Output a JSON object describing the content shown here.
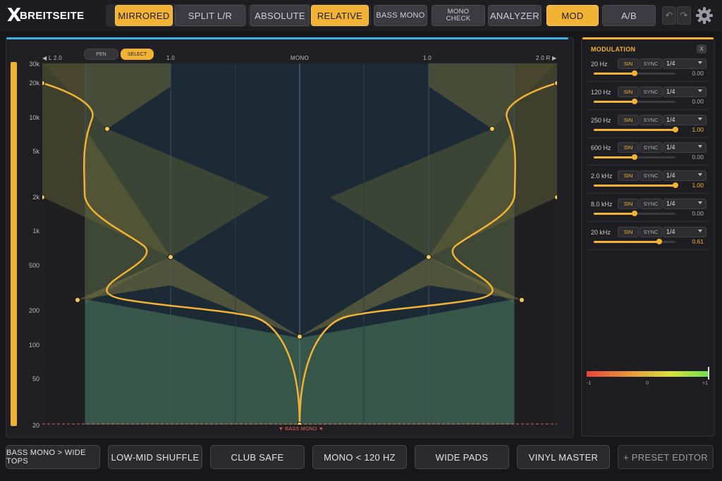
{
  "app": {
    "logo_mark": "X",
    "logo_text": "BREITSEITE"
  },
  "toolbar": {
    "mode": [
      "MIRRORED",
      "SPLIT L/R"
    ],
    "scale": [
      "ABSOLUTE",
      "RELATIVE"
    ],
    "bass_mono": "BASS MONO",
    "mono_check": "MONO CHECK",
    "analyzer": "ANALYZER",
    "mod": "MOD",
    "ab": "A/B",
    "undo_icon": "undo-icon",
    "redo_icon": "redo-icon",
    "settings_icon": "gear-icon",
    "active": [
      "MIRRORED",
      "RELATIVE",
      "MOD"
    ]
  },
  "editor": {
    "tools": [
      "PEN",
      "SELECT"
    ],
    "active_tool": "SELECT",
    "x_labels": {
      "left": "L 2.0",
      "left_mid": "1.0",
      "center": "MONO",
      "right_mid": "1.0",
      "right": "2.0 R"
    },
    "y_labels": [
      "30k",
      "20k",
      "10k",
      "5k",
      "2k",
      "1k",
      "500",
      "200",
      "100",
      "50",
      "20"
    ],
    "bass_mono_label": "BASS MONO",
    "colors": {
      "accent": "#f2b233",
      "plot_bg": "#1b2a35",
      "bass_mono_line": "#e2624f"
    }
  },
  "chart_data": {
    "type": "scatter",
    "title": "",
    "xlabel": "",
    "ylabel": "",
    "y_scale": "log",
    "ylim": [
      20,
      30000
    ],
    "xlim": [
      -2.0,
      2.0
    ],
    "series": [
      {
        "x": [
          -2.0,
          -1.6,
          -1.0,
          -1.7,
          0.0,
          0.0,
          1.0,
          1.7,
          1.6,
          2.0
        ],
        "y": [
          20000,
          8000,
          600,
          250,
          120,
          20,
          600,
          250,
          8000,
          20000
        ]
      },
      {
        "x": [
          -2.0,
          2.0
        ],
        "y": [
          2000,
          2000
        ]
      }
    ]
  },
  "modulation": {
    "title": "MODULATION",
    "close": "X",
    "sin": "SIN",
    "sync": "SYNC",
    "bands": [
      {
        "freq": "20 Hz",
        "rate": "1/4",
        "value": "0.00",
        "amount": 0.5
      },
      {
        "freq": "120 Hz",
        "rate": "1/4",
        "value": "0.00",
        "amount": 0.5
      },
      {
        "freq": "250 Hz",
        "rate": "1/4",
        "value": "1.00",
        "amount": 1.0
      },
      {
        "freq": "600 Hz",
        "rate": "1/4",
        "value": "0.00",
        "amount": 0.5
      },
      {
        "freq": "2.0 kHz",
        "rate": "1/4",
        "value": "1.00",
        "amount": 1.0
      },
      {
        "freq": "8.0 kHz",
        "rate": "1/4",
        "value": "0.00",
        "amount": 0.5
      },
      {
        "freq": "20 kHz",
        "rate": "1/4",
        "value": "0.61",
        "amount": 0.805
      }
    ],
    "meter": {
      "min": "-1",
      "mid": "0",
      "max": "+1",
      "level": 1.0
    }
  },
  "presets": [
    "BASS MONO > WIDE TOPS",
    "LOW-MID SHUFFLE",
    "CLUB SAFE",
    "MONO < 120 HZ",
    "WIDE PADS",
    "VINYL MASTER",
    "+ PRESET EDITOR"
  ]
}
